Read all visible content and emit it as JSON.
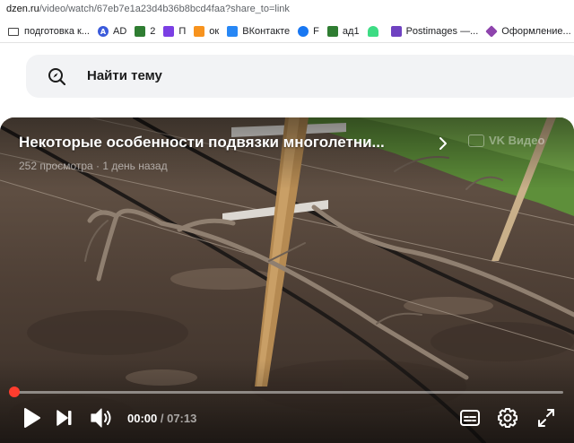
{
  "browser": {
    "url_host": "dzen.ru",
    "url_path": "/video/watch/67eb7e1a23d4b36b8bcd4faa?share_to=link"
  },
  "bookmarks": [
    {
      "label": "подготовка к...",
      "icon": "folder-icon",
      "color": "#444444",
      "glyph": ""
    },
    {
      "label": "AD",
      "icon": "ad-circle-icon",
      "color": "#3b5bdb",
      "glyph": "A"
    },
    {
      "label": "2",
      "icon": "image-bookmark-icon",
      "color": "#2f7d32",
      "glyph": "2"
    },
    {
      "label": "П",
      "icon": "purple-bookmark-icon",
      "color": "#7b3fe4",
      "glyph": "П"
    },
    {
      "label": "ок",
      "icon": "odnoklassniki-icon",
      "color": "#f7931e",
      "glyph": "ок"
    },
    {
      "label": "ВКонтакте",
      "icon": "vk-icon",
      "color": "#2787f5",
      "glyph": "vk"
    },
    {
      "label": "F",
      "icon": "facebook-icon",
      "color": "#1877f2",
      "glyph": "f"
    },
    {
      "label": "ад1",
      "icon": "image-bookmark-icon",
      "color": "#2f7d32",
      "glyph": "1"
    },
    {
      "label": "",
      "icon": "android-icon",
      "color": "#3ddc84",
      "glyph": ""
    },
    {
      "label": "Postimages —...",
      "icon": "postimages-icon",
      "color": "#6f42c1",
      "glyph": "P"
    },
    {
      "label": "Оформление...",
      "icon": "cube-icon",
      "color": "#8e44ad",
      "glyph": "◆"
    },
    {
      "label": "",
      "icon": "folder-icon",
      "color": "#444444",
      "glyph": ""
    }
  ],
  "search": {
    "label": "Найти тему",
    "icon": "compass-search-icon"
  },
  "video": {
    "title": "Некоторые особенности подвязки многолетни...",
    "meta": "252 просмотра · 1 день назад",
    "watermark": "VK Видео",
    "progress": 0.0,
    "time_current": "00:00",
    "time_separator": " / ",
    "time_total": "07:13",
    "accent_color": "#ff3d2e",
    "controls": [
      "play-icon",
      "next-icon",
      "volume-icon",
      "subtitles-icon",
      "settings-icon",
      "fullscreen-icon"
    ]
  }
}
